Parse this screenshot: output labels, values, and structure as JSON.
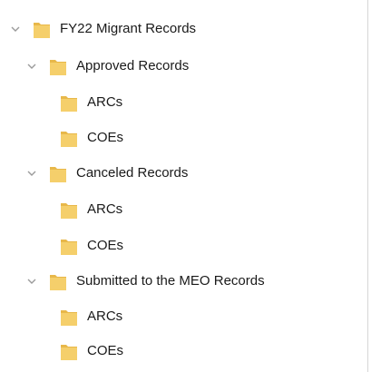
{
  "tree": {
    "root": {
      "label": "FY22 Migrant Records",
      "expanded": true,
      "icon": "folder-icon"
    },
    "groups": [
      {
        "label": "Approved Records",
        "expanded": true,
        "children": [
          {
            "label": "ARCs"
          },
          {
            "label": "COEs"
          }
        ]
      },
      {
        "label": "Canceled Records",
        "expanded": true,
        "children": [
          {
            "label": "ARCs"
          },
          {
            "label": "COEs"
          }
        ]
      },
      {
        "label": "Submitted to the MEO Records",
        "expanded": true,
        "children": [
          {
            "label": "ARCs"
          },
          {
            "label": "COEs"
          }
        ]
      }
    ]
  },
  "colors": {
    "folder_body": "#f5cf6b",
    "folder_tab": "#e8b84a",
    "chevron": "#9a9a9a",
    "text": "#1a1a1a"
  }
}
